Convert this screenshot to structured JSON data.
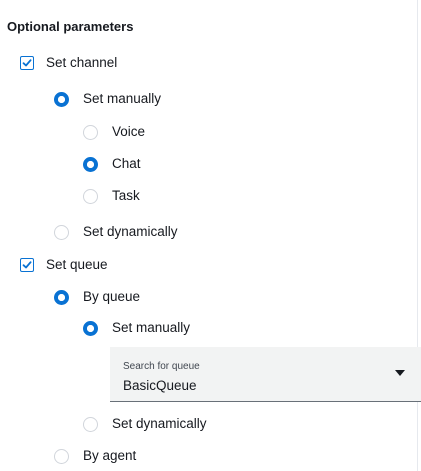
{
  "section": {
    "title": "Optional parameters"
  },
  "channel": {
    "checkbox_label": "Set channel",
    "checked": true,
    "manual_label": "Set manually",
    "options": [
      {
        "label": "Voice",
        "selected": false
      },
      {
        "label": "Chat",
        "selected": true
      },
      {
        "label": "Task",
        "selected": false
      }
    ],
    "dynamic_label": "Set dynamically"
  },
  "queue": {
    "checkbox_label": "Set queue",
    "checked": true,
    "by_queue_label": "By queue",
    "manual_label": "Set manually",
    "search": {
      "label": "Search for queue",
      "value": "BasicQueue",
      "icon": "caret-down-icon"
    },
    "dynamic_label": "Set dynamically",
    "by_agent_label": "By agent"
  },
  "colors": {
    "accent": "#0972d3",
    "text": "#16191f",
    "field_bg": "#f2f3f3"
  }
}
